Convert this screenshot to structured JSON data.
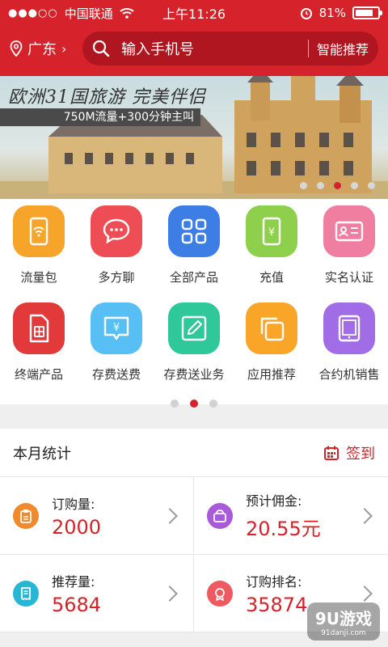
{
  "status_bar": {
    "carrier": "中国联通",
    "time": "上午11:26",
    "battery": "81%",
    "battery_level": 0.81
  },
  "header": {
    "location": "广东",
    "search_placeholder": "输入手机号",
    "recommend": "智能推荐"
  },
  "banner": {
    "title": "欧洲31国旅游 完美伴侣",
    "subtitle": "750M流量+300分钟主叫",
    "pages": 5,
    "active_page": 3
  },
  "grid": {
    "items": [
      {
        "label": "流量包",
        "icon": "phone-wifi-icon",
        "color": "#f7a42a"
      },
      {
        "label": "多方聊",
        "icon": "chat-bubble-icon",
        "color": "#ef4d55"
      },
      {
        "label": "全部产品",
        "icon": "grid-four-icon",
        "color": "#3d7ee6"
      },
      {
        "label": "充值",
        "icon": "phone-yen-icon",
        "color": "#8ed04b"
      },
      {
        "label": "实名认证",
        "icon": "id-card-icon",
        "color": "#f07ea0"
      },
      {
        "label": "终端产品",
        "icon": "sim-card-icon",
        "color": "#e23a3a"
      },
      {
        "label": "存费送费",
        "icon": "yen-bubble-icon",
        "color": "#57bff3"
      },
      {
        "label": "存费送业务",
        "icon": "edit-pencil-icon",
        "color": "#2fc89a"
      },
      {
        "label": "应用推荐",
        "icon": "copy-stack-icon",
        "color": "#f8a528"
      },
      {
        "label": "合约机销售",
        "icon": "tablet-icon",
        "color": "#a06de6"
      }
    ],
    "pages": 3,
    "active_page": 2
  },
  "stats": {
    "title": "本月统计",
    "signin": "签到",
    "items": [
      {
        "label": "订购量:",
        "value": "2000",
        "icon": "clipboard-icon",
        "color": "#f08a2c"
      },
      {
        "label": "预计佣金:",
        "value": "20.55元",
        "icon": "wallet-icon",
        "color": "#a85ad8"
      },
      {
        "label": "推荐量:",
        "value": "5684",
        "icon": "receipt-icon",
        "color": "#27b7d4"
      },
      {
        "label": "订购排名:",
        "value": "35874",
        "icon": "medal-icon",
        "color": "#ee5a60"
      }
    ]
  },
  "watermark": {
    "text": "9U游戏",
    "sub": "91danji.com"
  }
}
